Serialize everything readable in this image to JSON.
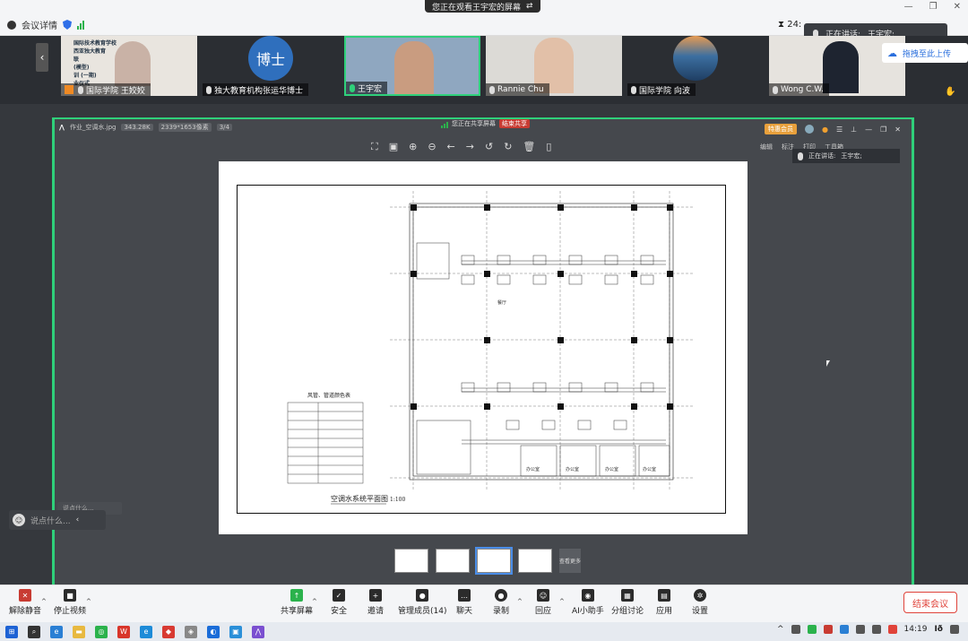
{
  "topbar": {
    "meeting_details": "会议详情",
    "share_banner": "您正在观看王宇宏的屏幕",
    "timer": "24:",
    "speaking_label": "正在讲话:",
    "speaking_name": "王宇宏;",
    "upload_label": "拖拽至此上传"
  },
  "participants": [
    {
      "name": "国际学院 王姣姣",
      "slide_lines": [
        "国际技术教育学校",
        "西亚独大教育",
        "联",
        "(模型)",
        "训 (一期)",
        "业仪式"
      ]
    },
    {
      "name": "独大教育机构张运华博士",
      "avatar_text": "博士"
    },
    {
      "name": "王宇宏"
    },
    {
      "name": "Rannie Chu"
    },
    {
      "name": "国际学院 向波"
    },
    {
      "name": "Wong C.W."
    }
  ],
  "viewer": {
    "file_name": "作业_空调水.jpg",
    "file_size": "343.28K",
    "dimensions": "2339*1653像素",
    "page": "3/4",
    "share_status": "您正在共享屏幕",
    "stop_share": "结束共享",
    "member_badge": "特惠会员",
    "edit_label": "编辑",
    "tool2": "标注",
    "tool3": "打印",
    "tool4": "工具箱",
    "speaking_label": "正在讲话:",
    "speaking_name": "王宇宏;",
    "more_label": "查看更多"
  },
  "drawing": {
    "title": "空调水系统平面图",
    "scale": "1:100",
    "legend_title": "风管、管道颜色表",
    "hall_label": "餐厅",
    "room_labels": [
      "办公室",
      "办公室",
      "办公室",
      "办公室"
    ]
  },
  "chat": {
    "mini_label": "说点什么...",
    "placeholder": "说点什么..."
  },
  "toolbar": {
    "unmute": "解除静音",
    "stop_video": "停止视频",
    "share_screen": "共享屏幕",
    "security": "安全",
    "invite": "邀请",
    "members": "管理成员(14)",
    "chat": "聊天",
    "record": "录制",
    "replay": "回应",
    "ai_assistant": "AI小助手",
    "breakout": "分组讨论",
    "apps": "应用",
    "settings": "设置",
    "end_meeting": "结束会议"
  },
  "taskbar": {
    "clock": "14:19"
  },
  "colors": {
    "accent_green": "#2fd07a",
    "end_red": "#e0433a",
    "stop_share_red": "#c83b32",
    "member_orange": "#e8a03c"
  }
}
